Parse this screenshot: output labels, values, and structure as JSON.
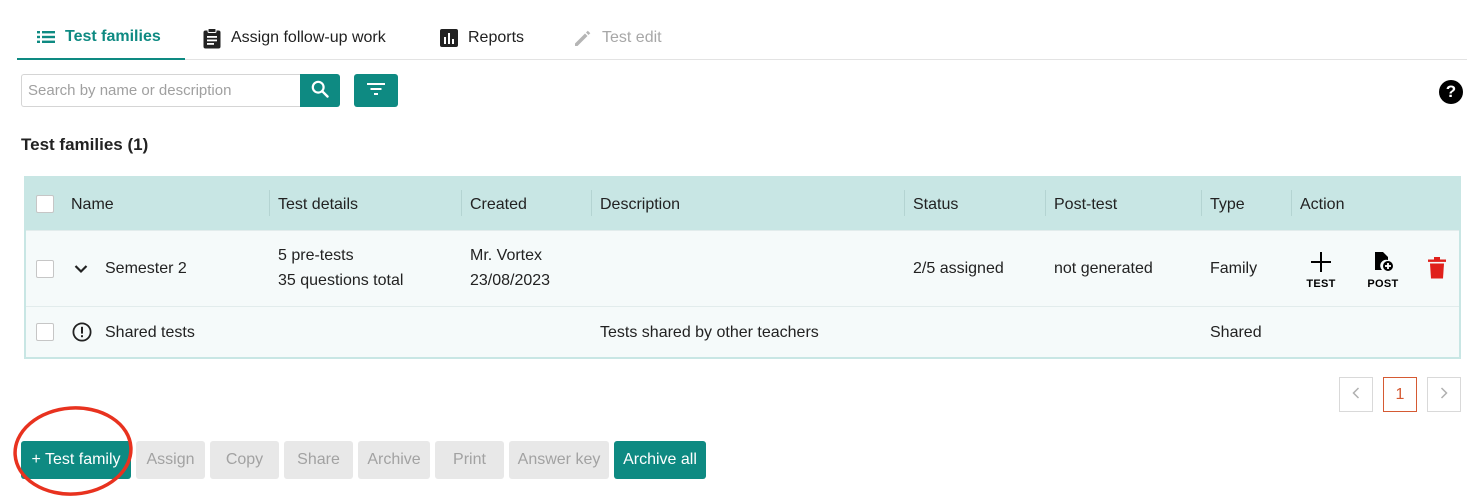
{
  "tabs": [
    {
      "label": "Test families",
      "icon": "list-icon",
      "active": true
    },
    {
      "label": "Assign follow-up work",
      "icon": "clipboard-icon"
    },
    {
      "label": "Reports",
      "icon": "bar-chart-icon"
    },
    {
      "label": "Test edit",
      "icon": "pencil-icon",
      "disabled": true
    }
  ],
  "search": {
    "placeholder": "Search by name or description",
    "value": ""
  },
  "help": {
    "label": "?"
  },
  "section": {
    "title": "Test families (1)"
  },
  "table": {
    "columns": [
      "Name",
      "Test details",
      "Created",
      "Description",
      "Status",
      "Post-test",
      "Type",
      "Action"
    ],
    "rows": [
      {
        "name": "Semester 2",
        "details_line1": "5 pre-tests",
        "details_line2": "35 questions total",
        "created_by": "Mr. Vortex",
        "created_date": "23/08/2023",
        "description": "",
        "status": "2/5 assigned",
        "post_test": "not generated",
        "type": "Family",
        "actions": {
          "test_label": "TEST",
          "post_label": "POST"
        }
      },
      {
        "name": "Shared tests",
        "description": "Tests shared by other teachers",
        "type": "Shared"
      }
    ]
  },
  "pagination": {
    "current": "1",
    "prev": "<",
    "next": ">"
  },
  "buttons": {
    "test_family": "+ Test family",
    "assign": "Assign",
    "copy": "Copy",
    "share": "Share",
    "archive": "Archive",
    "print": "Print",
    "answer_key": "Answer key",
    "archive_all": "Archive all"
  },
  "colors": {
    "accent": "#0e8a82",
    "header_bg": "#c8e6e4",
    "delete": "#e0201b",
    "highlight": "#e8321f",
    "page_active": "#d55a33"
  }
}
